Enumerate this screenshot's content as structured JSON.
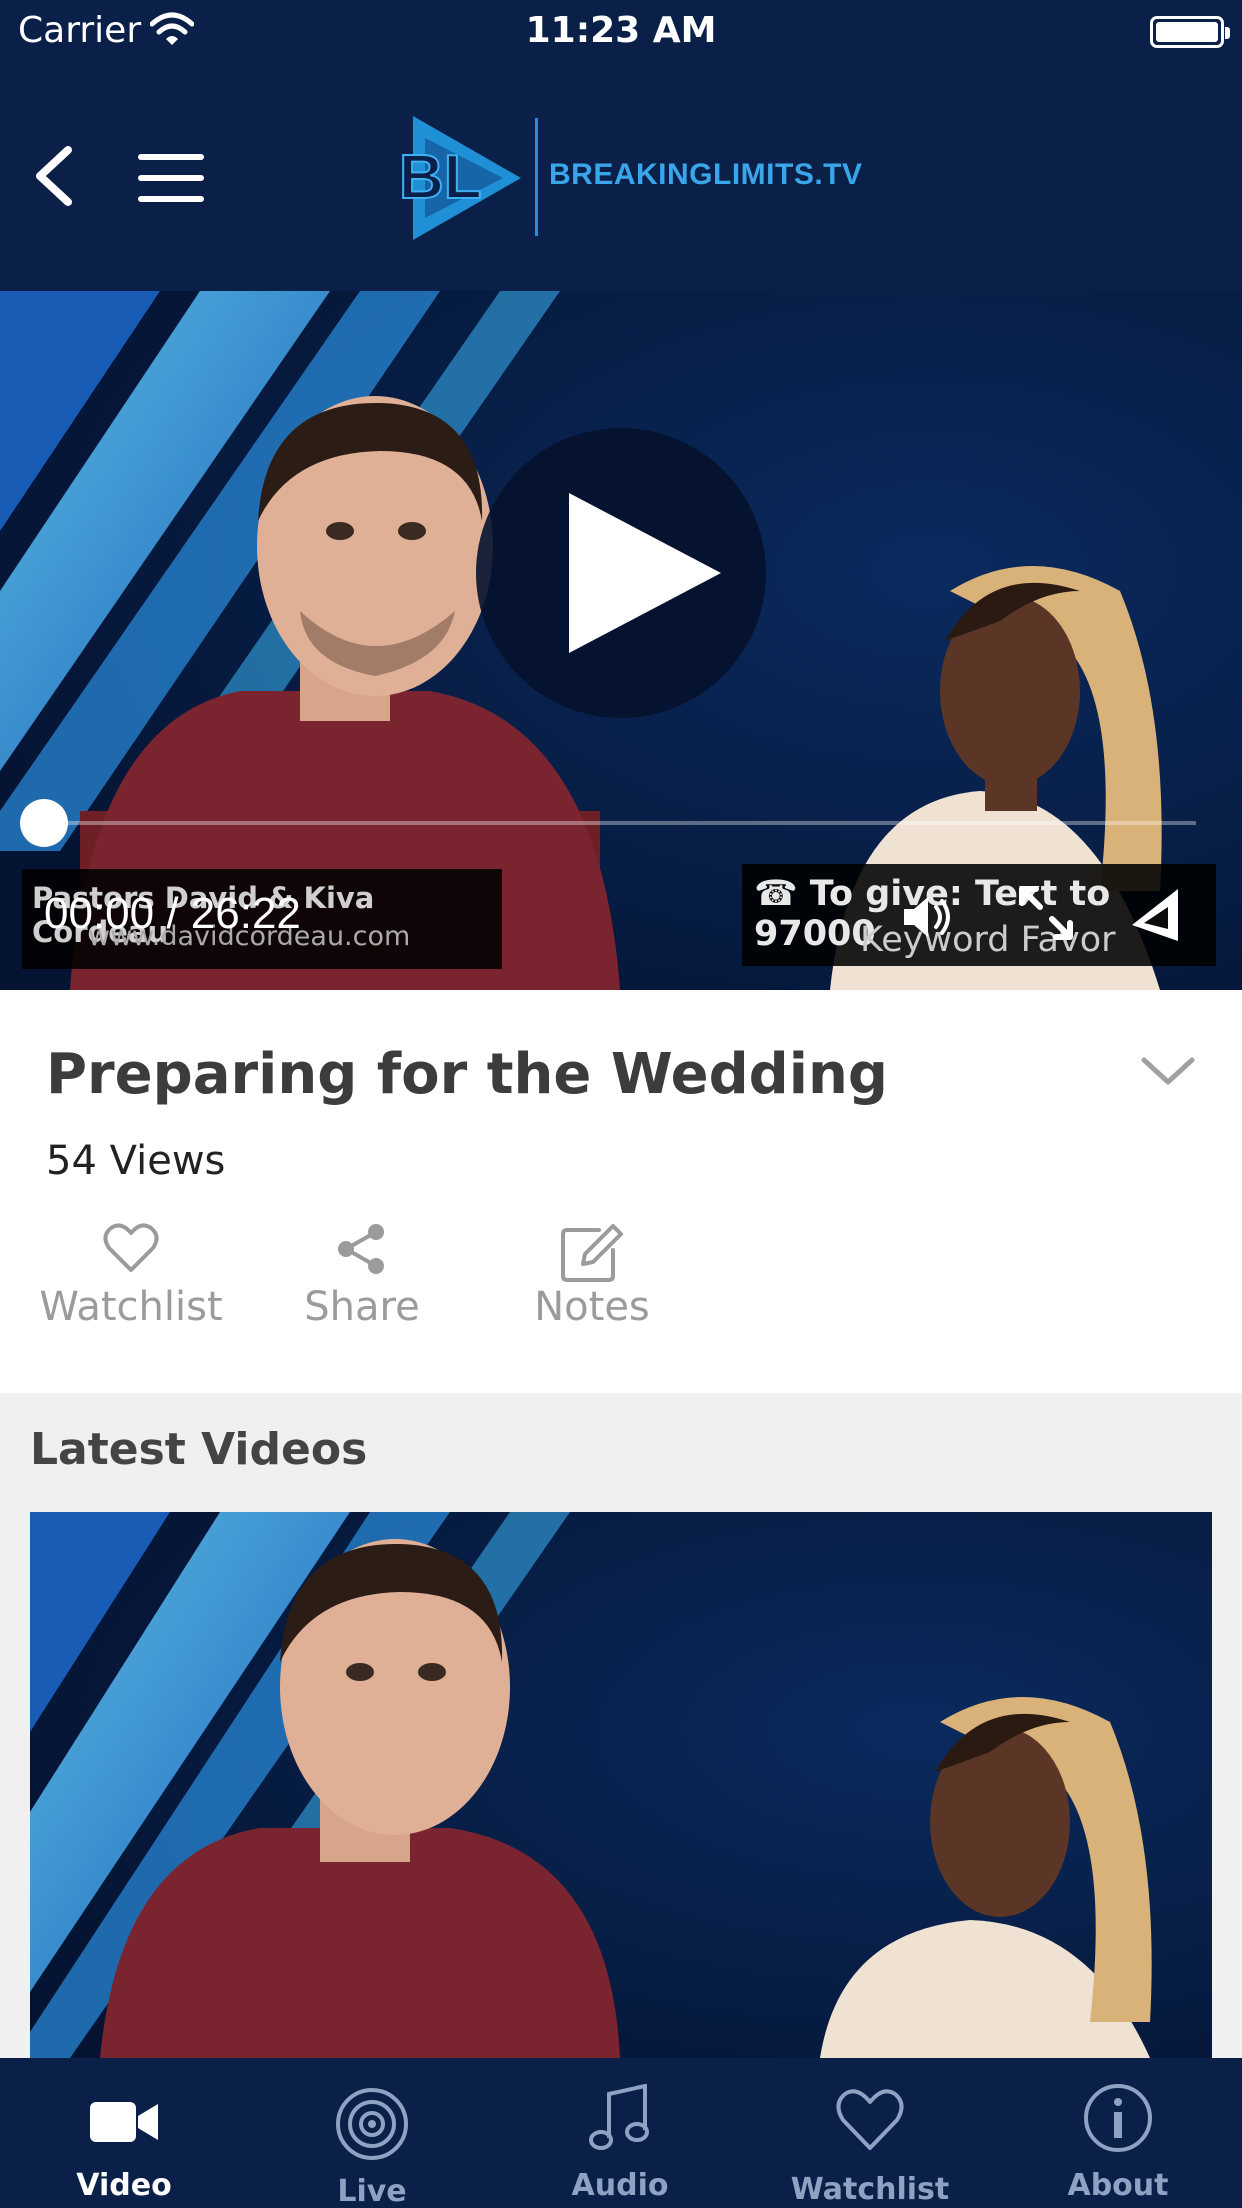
{
  "status_bar": {
    "carrier": "Carrier",
    "time": "11:23 AM"
  },
  "header": {
    "brand": "BREAKINGLIMITS.TV",
    "logo_letters": "BL",
    "icons": [
      "back-icon",
      "menu-icon"
    ]
  },
  "player": {
    "timecode": "00:00 / 26:22",
    "progress": 0,
    "overlay_left_line1": "Pastors David & Kiva Cordeau",
    "overlay_left_line2": "www.davidcordeau.com",
    "overlay_right_line1": "☎ To give: Text to 97000",
    "overlay_right_line2": "Keyword Favor",
    "icons": [
      "play-icon",
      "volume-icon",
      "fullscreen-icon",
      "cast-icon"
    ]
  },
  "video": {
    "title": "Preparing for the Wedding",
    "views": "54 Views",
    "actions": [
      {
        "label": "Watchlist",
        "icon": "heart-icon"
      },
      {
        "label": "Share",
        "icon": "share-icon"
      },
      {
        "label": "Notes",
        "icon": "edit-icon"
      }
    ]
  },
  "latest": {
    "heading": "Latest Videos"
  },
  "tabs": [
    {
      "label": "Video",
      "icon": "video-camera-icon",
      "active": true
    },
    {
      "label": "Live",
      "icon": "broadcast-icon",
      "active": false
    },
    {
      "label": "Audio",
      "icon": "music-note-icon",
      "active": false
    },
    {
      "label": "Watchlist",
      "icon": "heart-icon",
      "active": false
    },
    {
      "label": "About",
      "icon": "info-icon",
      "active": false
    }
  ],
  "colors": {
    "navy": "#0b2049",
    "brand_blue": "#3aa6ea",
    "tab_inactive": "#8fa2c4",
    "action_gray": "#9b9b9b"
  }
}
